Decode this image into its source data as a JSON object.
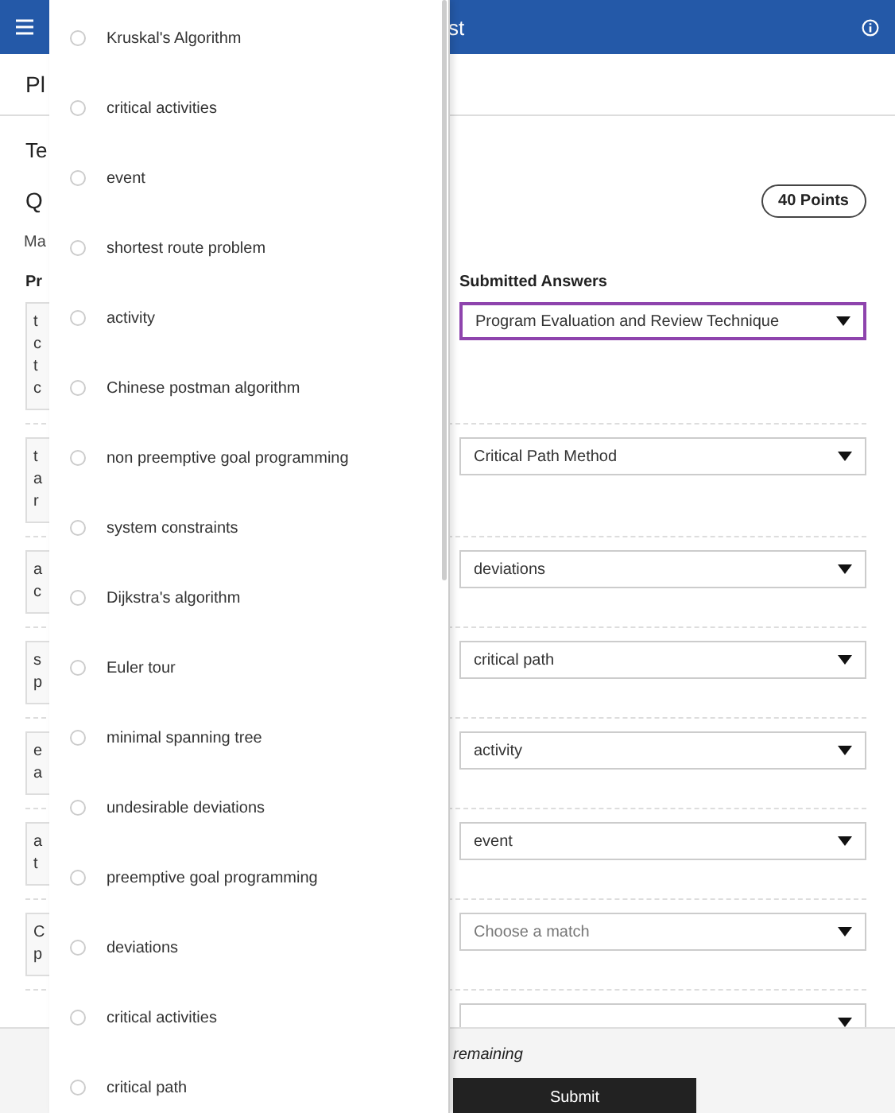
{
  "header": {
    "title": "st"
  },
  "page_title": "Pl",
  "test_label": "Te",
  "question_label": "Q",
  "points": "40 Points",
  "instructions": "Ma",
  "columns": {
    "prompts": "Pr",
    "answers": "Submitted Answers"
  },
  "rows": [
    {
      "prompt_lines": [
        "t",
        "c",
        "t",
        "c"
      ],
      "answer": "Program Evaluation and Review Technique",
      "focused": true
    },
    {
      "prompt_lines": [
        "t",
        "a",
        "r"
      ],
      "answer": "Critical Path Method",
      "focused": false
    },
    {
      "prompt_lines": [
        "a",
        "c"
      ],
      "answer": "deviations",
      "focused": false
    },
    {
      "prompt_lines": [
        "s",
        "p"
      ],
      "answer": "critical path",
      "focused": false
    },
    {
      "prompt_lines": [
        "e",
        "a"
      ],
      "answer": "activity",
      "focused": false
    },
    {
      "prompt_lines": [
        "a",
        "t"
      ],
      "answer": "event",
      "focused": false
    },
    {
      "prompt_lines": [
        "C",
        "p"
      ],
      "placeholder": "Choose a match",
      "focused": false
    },
    {
      "focused": false
    }
  ],
  "options": [
    {
      "label": "Kruskal's Algorithm",
      "selected": false
    },
    {
      "label": "critical activities",
      "selected": false
    },
    {
      "label": "event",
      "selected": false
    },
    {
      "label": "shortest route problem",
      "selected": false
    },
    {
      "label": "activity",
      "selected": false
    },
    {
      "label": "Chinese postman algorithm",
      "selected": false
    },
    {
      "label": "non preemptive goal programming",
      "selected": false
    },
    {
      "label": "system constraints",
      "selected": false
    },
    {
      "label": "Dijkstra's algorithm",
      "selected": false
    },
    {
      "label": "Euler tour",
      "selected": false
    },
    {
      "label": "minimal spanning tree",
      "selected": false
    },
    {
      "label": "undesirable deviations",
      "selected": false
    },
    {
      "label": "preemptive goal programming",
      "selected": false
    },
    {
      "label": "deviations",
      "selected": false
    },
    {
      "label": "critical activities",
      "selected": false
    },
    {
      "label": "critical path",
      "selected": false
    }
  ],
  "footer": {
    "status": "remaining",
    "submit": "Submit"
  }
}
